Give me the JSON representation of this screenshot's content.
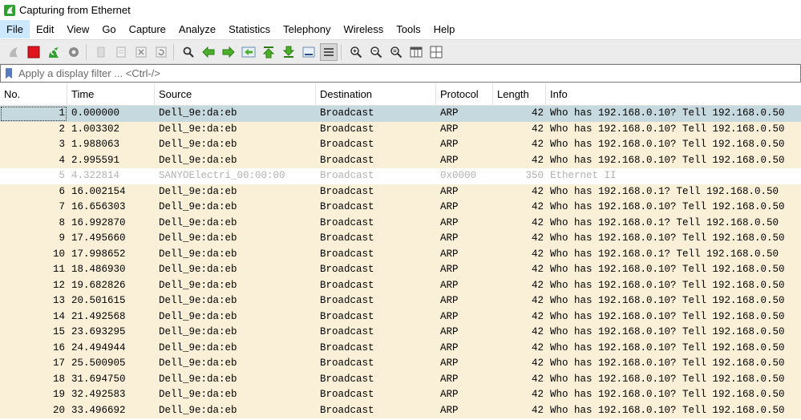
{
  "window": {
    "title": "Capturing from Ethernet"
  },
  "menu": [
    "File",
    "Edit",
    "View",
    "Go",
    "Capture",
    "Analyze",
    "Statistics",
    "Telephony",
    "Wireless",
    "Tools",
    "Help"
  ],
  "filter": {
    "placeholder": "Apply a display filter ... <Ctrl-/>"
  },
  "columns": [
    "No.",
    "Time",
    "Source",
    "Destination",
    "Protocol",
    "Length",
    "Info"
  ],
  "packets": [
    {
      "no": "1",
      "time": "0.000000",
      "src": "Dell_9e:da:eb",
      "dst": "Broadcast",
      "proto": "ARP",
      "len": "42",
      "info": "Who has 192.168.0.10? Tell 192.168.0.50"
    },
    {
      "no": "2",
      "time": "1.003302",
      "src": "Dell_9e:da:eb",
      "dst": "Broadcast",
      "proto": "ARP",
      "len": "42",
      "info": "Who has 192.168.0.10? Tell 192.168.0.50"
    },
    {
      "no": "3",
      "time": "1.988063",
      "src": "Dell_9e:da:eb",
      "dst": "Broadcast",
      "proto": "ARP",
      "len": "42",
      "info": "Who has 192.168.0.10? Tell 192.168.0.50"
    },
    {
      "no": "4",
      "time": "2.995591",
      "src": "Dell_9e:da:eb",
      "dst": "Broadcast",
      "proto": "ARP",
      "len": "42",
      "info": "Who has 192.168.0.10? Tell 192.168.0.50"
    },
    {
      "no": "5",
      "time": "4.322814",
      "src": "SANYOElectri_00:00:00",
      "dst": "Broadcast",
      "proto": "0x0000",
      "len": "350",
      "info": "Ethernet II"
    },
    {
      "no": "6",
      "time": "16.002154",
      "src": "Dell_9e:da:eb",
      "dst": "Broadcast",
      "proto": "ARP",
      "len": "42",
      "info": "Who has 192.168.0.1? Tell 192.168.0.50"
    },
    {
      "no": "7",
      "time": "16.656303",
      "src": "Dell_9e:da:eb",
      "dst": "Broadcast",
      "proto": "ARP",
      "len": "42",
      "info": "Who has 192.168.0.10? Tell 192.168.0.50"
    },
    {
      "no": "8",
      "time": "16.992870",
      "src": "Dell_9e:da:eb",
      "dst": "Broadcast",
      "proto": "ARP",
      "len": "42",
      "info": "Who has 192.168.0.1? Tell 192.168.0.50"
    },
    {
      "no": "9",
      "time": "17.495660",
      "src": "Dell_9e:da:eb",
      "dst": "Broadcast",
      "proto": "ARP",
      "len": "42",
      "info": "Who has 192.168.0.10? Tell 192.168.0.50"
    },
    {
      "no": "10",
      "time": "17.998652",
      "src": "Dell_9e:da:eb",
      "dst": "Broadcast",
      "proto": "ARP",
      "len": "42",
      "info": "Who has 192.168.0.1? Tell 192.168.0.50"
    },
    {
      "no": "11",
      "time": "18.486930",
      "src": "Dell_9e:da:eb",
      "dst": "Broadcast",
      "proto": "ARP",
      "len": "42",
      "info": "Who has 192.168.0.10? Tell 192.168.0.50"
    },
    {
      "no": "12",
      "time": "19.682826",
      "src": "Dell_9e:da:eb",
      "dst": "Broadcast",
      "proto": "ARP",
      "len": "42",
      "info": "Who has 192.168.0.10? Tell 192.168.0.50"
    },
    {
      "no": "13",
      "time": "20.501615",
      "src": "Dell_9e:da:eb",
      "dst": "Broadcast",
      "proto": "ARP",
      "len": "42",
      "info": "Who has 192.168.0.10? Tell 192.168.0.50"
    },
    {
      "no": "14",
      "time": "21.492568",
      "src": "Dell_9e:da:eb",
      "dst": "Broadcast",
      "proto": "ARP",
      "len": "42",
      "info": "Who has 192.168.0.10? Tell 192.168.0.50"
    },
    {
      "no": "15",
      "time": "23.693295",
      "src": "Dell_9e:da:eb",
      "dst": "Broadcast",
      "proto": "ARP",
      "len": "42",
      "info": "Who has 192.168.0.10? Tell 192.168.0.50"
    },
    {
      "no": "16",
      "time": "24.494944",
      "src": "Dell_9e:da:eb",
      "dst": "Broadcast",
      "proto": "ARP",
      "len": "42",
      "info": "Who has 192.168.0.10? Tell 192.168.0.50"
    },
    {
      "no": "17",
      "time": "25.500905",
      "src": "Dell_9e:da:eb",
      "dst": "Broadcast",
      "proto": "ARP",
      "len": "42",
      "info": "Who has 192.168.0.10? Tell 192.168.0.50"
    },
    {
      "no": "18",
      "time": "31.694750",
      "src": "Dell_9e:da:eb",
      "dst": "Broadcast",
      "proto": "ARP",
      "len": "42",
      "info": "Who has 192.168.0.10? Tell 192.168.0.50"
    },
    {
      "no": "19",
      "time": "32.492583",
      "src": "Dell_9e:da:eb",
      "dst": "Broadcast",
      "proto": "ARP",
      "len": "42",
      "info": "Who has 192.168.0.10? Tell 192.168.0.50"
    },
    {
      "no": "20",
      "time": "33.496692",
      "src": "Dell_9e:da:eb",
      "dst": "Broadcast",
      "proto": "ARP",
      "len": "42",
      "info": "Who has 192.168.0.10? Tell 192.168.0.50"
    }
  ],
  "colors": {
    "arp_row": "#faf0d7",
    "selected_row": "#c6d9de",
    "ignored_row": "#ffffff",
    "stop_red": "#e0141e",
    "fin_green": "#2fa12f"
  }
}
